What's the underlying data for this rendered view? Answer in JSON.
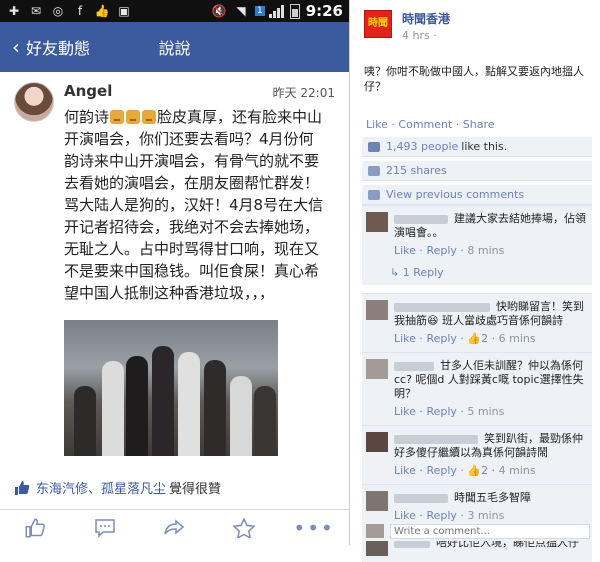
{
  "status_bar": {
    "time": "9:26",
    "sim": "1"
  },
  "header": {
    "back_label": "好友動態",
    "title": "說說"
  },
  "post": {
    "author": "Angel",
    "time": "昨天 22:01",
    "text_before_thumbs": "何韵诗",
    "text_after_thumbs": "脸皮真厚，还有脸来中山开演唱会，你们还要去看吗？4月份何韵诗来中山开演唱会，有骨气的就不要去看她的演唱会，在朋友圈帮忙群发！骂大陆人是狗的，汉奸！4月8号在大信开记者招待会，我绝对不会去捧她场，无耻之人。占中时骂得甘口响，现在又不是要来中国稳钱。叫佢食屎！真心希望中国人抵制这种香港垃圾，，，",
    "likes_names": "东海汽修、孤星落凡尘",
    "likes_suffix": "覺得很贊"
  },
  "fb": {
    "page_name": "時聞香港",
    "page_time": "4 hrs ·",
    "logo_text": "時聞",
    "post_text": "咦？你咁不恥做中國人，點解又要返內地搵人仔？",
    "actions": "Like · Comment · Share",
    "likes_count": "1,493 people",
    "likes_suffix": "like this.",
    "shares": "215 shares",
    "view_previous": "View previous comments",
    "comments": [
      {
        "text": "建議大家去結她捧場，佔領演唱會。。",
        "like": "Like",
        "reply": "Reply",
        "time": "8 mins",
        "likes": ""
      },
      {
        "text": "快哟睇留言！笑到我抽筋😆 班人當歧處巧音係何韻詩",
        "like": "Like",
        "reply": "Reply",
        "time": "6 mins",
        "likes": "2"
      },
      {
        "text": "甘多人佢未訓醒？仲以為係何cc? 呢個d 人對踩黃c嘅 topic選擇性失明？",
        "like": "Like",
        "reply": "Reply",
        "time": "5 mins",
        "likes": ""
      },
      {
        "text": "笑到趴街，最勁係仲好多傻仔繼續以為真係何韻詩鬧",
        "like": "Like",
        "reply": "Reply",
        "time": "4 mins",
        "likes": "2"
      },
      {
        "text": "時聞五毛多智障",
        "like": "Like",
        "reply": "Reply",
        "time": "3 mins",
        "likes": ""
      },
      {
        "text": "唔好比佢入境，睇佢点搵人仔",
        "like": "",
        "reply": "",
        "time": "",
        "likes": ""
      }
    ],
    "reply_link": "1 Reply",
    "write_placeholder": "Write a comment..."
  }
}
